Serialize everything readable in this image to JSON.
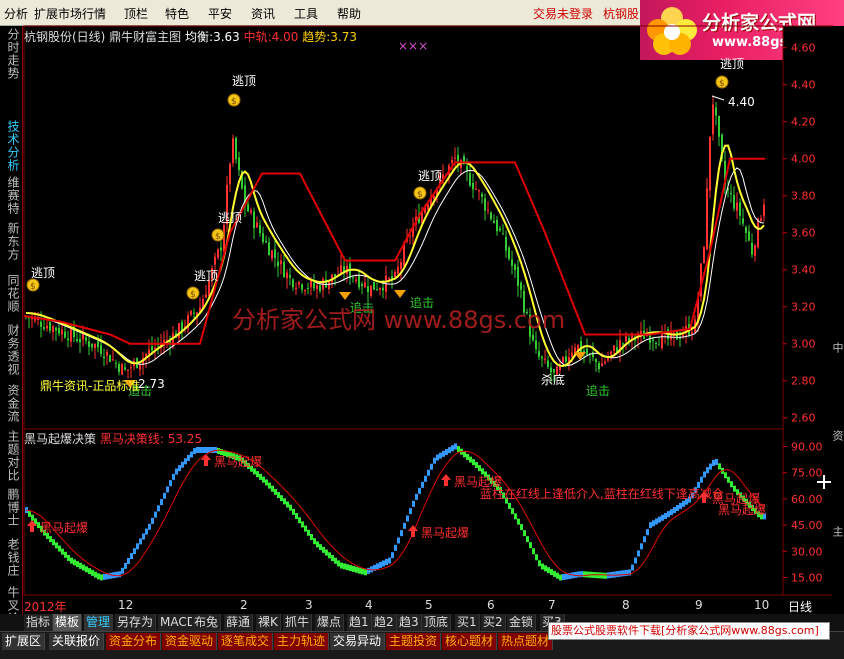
{
  "menu": {
    "items": [
      "分析",
      "扩展市场行情",
      "顶栏",
      "特色",
      "平安",
      "资讯",
      "工具",
      "帮助"
    ],
    "trade_status": "交易未登录",
    "stock_short": "杭钢股"
  },
  "logo": {
    "title": "分析家公式网",
    "url": "www.88gs.com"
  },
  "left_nav": [
    "分时走势",
    "技术分析",
    "维赛特",
    "新东方",
    "同花顺",
    "财务透视",
    "资金流",
    "主题对比",
    "鹏博士",
    "老钱庄",
    "牛叉诊"
  ],
  "right_nav": [
    "中",
    "资",
    "主"
  ],
  "header": {
    "stock": "杭钢股份(日线) 鼎牛财富主图",
    "avg_label": "均衡:",
    "avg_value": "3.63",
    "mid_label": "中轨:",
    "mid_value": "4.00",
    "trend_label": "趋势:",
    "trend_value": "3.73",
    "marks": "×××"
  },
  "main_chart": {
    "price_ticks": [
      "4.60",
      "4.40",
      "4.20",
      "4.00",
      "3.80",
      "3.60",
      "3.40",
      "3.20",
      "3.00",
      "2.80",
      "2.60"
    ],
    "watermark": "分析家公式网 www.88gs.com",
    "labels": {
      "escape_top": "逃顶",
      "chase": "追击",
      "kill_bottom": "杀底",
      "high_price": "4.40",
      "low_price": "2.73",
      "source": "鼎牛资讯-正品标准"
    },
    "colors": {
      "up": "#ff3030",
      "down": "#33cc33",
      "mid_line": "#e00000",
      "avg_line": "#ffffff",
      "trend_line": "#ffff33"
    }
  },
  "indicator": {
    "title": "黑马起爆决策",
    "line_label": "黑马决策线:",
    "line_value": "53.25",
    "ticks": [
      "90.00",
      "75.00",
      "60.00",
      "45.00",
      "30.00",
      "15.00"
    ],
    "signal_label": "黑马起爆",
    "note": "蓝柱在红线上逢低介入,蓝柱在红线下逢高减仓"
  },
  "time_axis": {
    "year": "2012年",
    "months": [
      "12",
      "2",
      "3",
      "4",
      "5",
      "6",
      "7",
      "8",
      "9",
      "10"
    ],
    "period": "日线"
  },
  "tabs": [
    "指标",
    "模板",
    "管理",
    "另存为",
    "MACD",
    "布兔",
    "薛通",
    "裸K",
    "抓牛",
    "爆点",
    "趋1",
    "趋2",
    "趋3",
    "顶底",
    "买1",
    "买2",
    "金锁",
    "买3"
  ],
  "bottom_tabs": [
    "扩展区",
    "关联报价",
    "资金分布",
    "资金驱动",
    "逐笔成交",
    "主力轨迹",
    "交易异动",
    "主题投资",
    "核心题材",
    "热点题材"
  ],
  "ad": "股票公式股票软件下载[分析家公式网www.88gs.com]"
}
